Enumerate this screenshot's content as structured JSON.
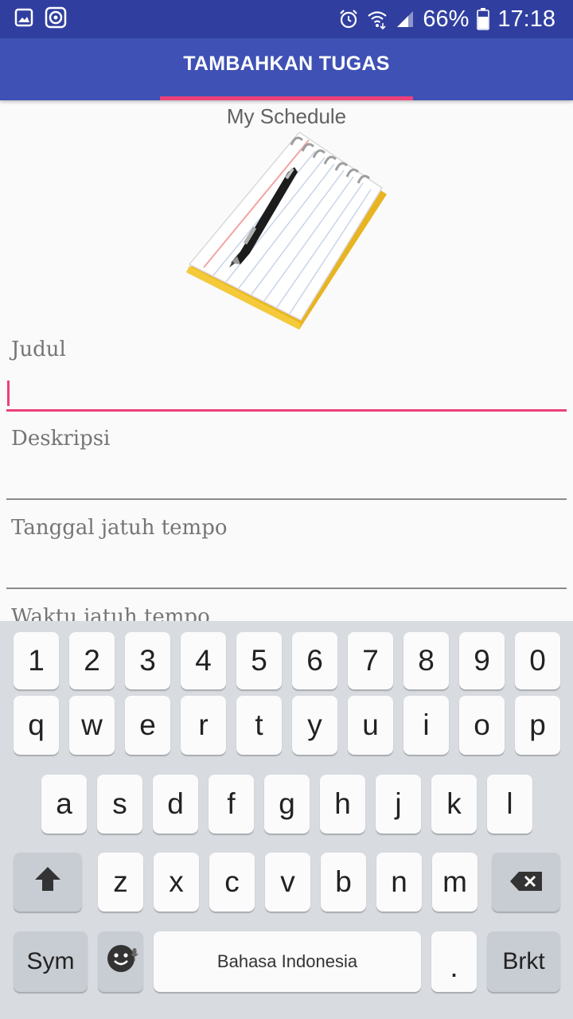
{
  "status_bar": {
    "left_icons": [
      "image-icon",
      "media-icon"
    ],
    "right_icons": [
      "alarm-icon",
      "wifi-icon",
      "signal-icon",
      "battery-icon"
    ],
    "battery": "66%",
    "time": "17:18"
  },
  "app_bar": {
    "title": "TAMBAHKAN TUGAS",
    "accent_color": "#ec407a",
    "primary_color": "#3f51b5",
    "status_color": "#303f9f"
  },
  "content": {
    "subtitle": "My Schedule",
    "image_icon": "notepad-pen-icon",
    "fields": [
      {
        "label": "Judul",
        "value": ""
      },
      {
        "label": "Deskripsi",
        "value": ""
      },
      {
        "label": "Tanggal jatuh tempo",
        "value": ""
      },
      {
        "label": "Waktu jatuh tempo",
        "value": ""
      }
    ]
  },
  "keyboard": {
    "row_numbers": [
      "1",
      "2",
      "3",
      "4",
      "5",
      "6",
      "7",
      "8",
      "9",
      "0"
    ],
    "row_top": [
      "q",
      "w",
      "e",
      "r",
      "t",
      "y",
      "u",
      "i",
      "o",
      "p"
    ],
    "row_middle": [
      "a",
      "s",
      "d",
      "f",
      "g",
      "h",
      "j",
      "k",
      "l"
    ],
    "row_bottom": [
      "z",
      "x",
      "c",
      "v",
      "b",
      "n",
      "m"
    ],
    "shift_icon": "shift-arrow-icon",
    "backspace_icon": "backspace-icon",
    "sym_label": "Sym",
    "emoji_icon": "emoji-icon",
    "mic_icon": "mic-icon",
    "space_label": "Bahasa Indonesia",
    "period_label": ".",
    "enter_label": "Brkt"
  }
}
